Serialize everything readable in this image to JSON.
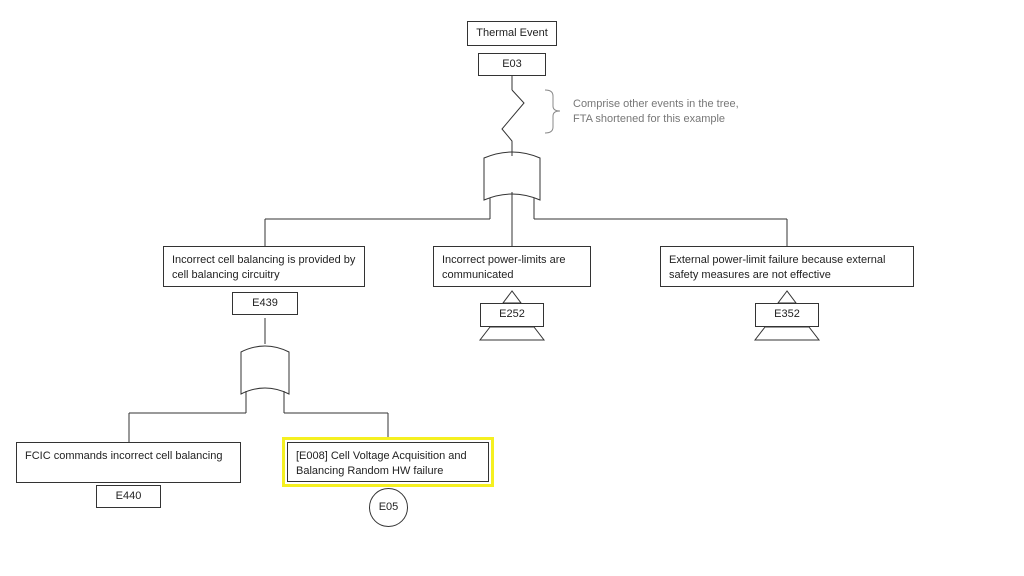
{
  "diagram": {
    "type": "fault-tree",
    "top_event": {
      "label": "Thermal Event",
      "id": "E03"
    },
    "annotation": "Comprise other  events in the tree,\nFTA shortened for this example",
    "level1": [
      {
        "label": "Incorrect  cell balancing is provided by cell balancing circuitry",
        "id": "E439",
        "kind": "gate-or"
      },
      {
        "label": "Incorrect  power-limits are communicated",
        "id": "E252",
        "kind": "transfer"
      },
      {
        "label": "External power-limit  failure because external safety measures are not  effective",
        "id": "E352",
        "kind": "transfer"
      }
    ],
    "level2": [
      {
        "label": "FCIC commands  incorrect  cell balancing",
        "id": "E440",
        "kind": "event"
      },
      {
        "label": "[E008] Cell Voltage Acquisition and Balancing Random HW failure",
        "id": "E05",
        "kind": "basic",
        "highlighted": true
      }
    ],
    "colors": {
      "line": "#333333",
      "highlight": "#f5f020",
      "annotation": "#777777"
    }
  }
}
